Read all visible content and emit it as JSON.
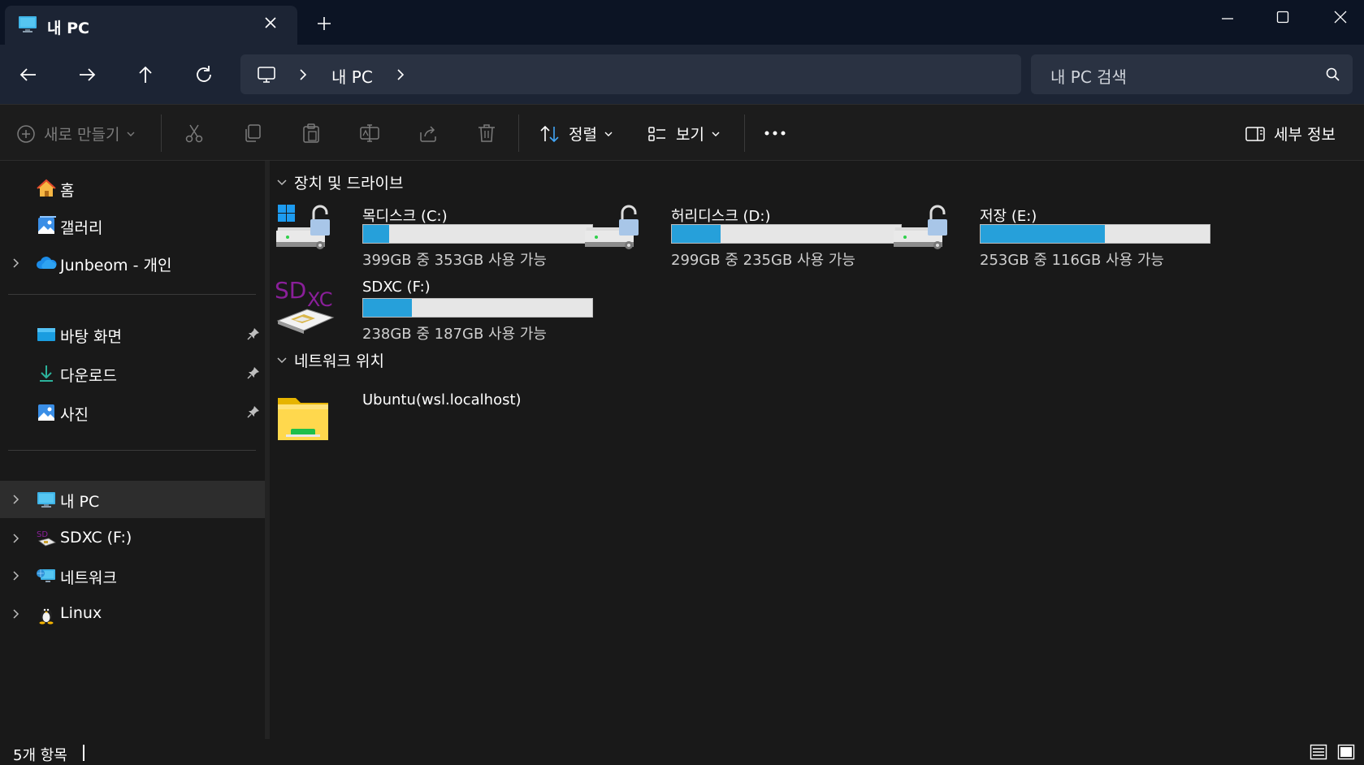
{
  "window": {
    "tab_title": "내 PC",
    "new_tab_symbol": "+"
  },
  "nav": {
    "breadcrumb": [
      "내 PC"
    ],
    "search_placeholder": "내 PC 검색"
  },
  "toolbar": {
    "new_label": "새로 만들기",
    "sort_label": "정렬",
    "view_label": "보기",
    "details_label": "세부 정보"
  },
  "sidebar": {
    "quick": [
      {
        "label": "홈",
        "icon": "home-icon"
      },
      {
        "label": "갤러리",
        "icon": "gallery-icon"
      },
      {
        "label": "Junbeom - 개인",
        "icon": "onedrive-cloud-icon",
        "expandable": true
      }
    ],
    "pinned": [
      {
        "label": "바탕 화면",
        "icon": "desktop-folder-icon",
        "pinned": true
      },
      {
        "label": "다운로드",
        "icon": "download-icon",
        "pinned": true
      },
      {
        "label": "사진",
        "icon": "pictures-icon",
        "pinned": true
      }
    ],
    "locations": [
      {
        "label": "내 PC",
        "icon": "this-pc-icon",
        "expandable": true,
        "selected": true
      },
      {
        "label": "SDXC (F:)",
        "icon": "sd-card-icon",
        "expandable": true
      },
      {
        "label": "네트워크",
        "icon": "network-icon",
        "expandable": true
      },
      {
        "label": "Linux",
        "icon": "linux-penguin-icon",
        "expandable": true
      }
    ]
  },
  "content": {
    "group_drives": "장치 및 드라이브",
    "group_network": "네트워크 위치",
    "drives": [
      {
        "name": "목디스크 (C:)",
        "free": "399GB 중 353GB 사용 가능",
        "used_fraction": 0.115,
        "icon": "windows-drive-icon"
      },
      {
        "name": "허리디스크 (D:)",
        "free": "299GB 중 235GB 사용 가능",
        "used_fraction": 0.214,
        "icon": "locked-drive-icon"
      },
      {
        "name": "저장 (E:)",
        "free": "253GB 중 116GB 사용 가능",
        "used_fraction": 0.541,
        "icon": "locked-drive-icon"
      },
      {
        "name": "SDXC (F:)",
        "free": "238GB 중 187GB 사용 가능",
        "used_fraction": 0.214,
        "icon": "sdxc-card-icon"
      }
    ],
    "network_locations": [
      {
        "name": "Ubuntu(wsl.localhost)",
        "icon": "network-folder-icon"
      }
    ]
  },
  "status": {
    "item_count": "5개 항목"
  },
  "colors": {
    "accent": "#26a0da",
    "titlebar": "#0c1424",
    "navbar": "#1c2434",
    "background": "#191919"
  }
}
